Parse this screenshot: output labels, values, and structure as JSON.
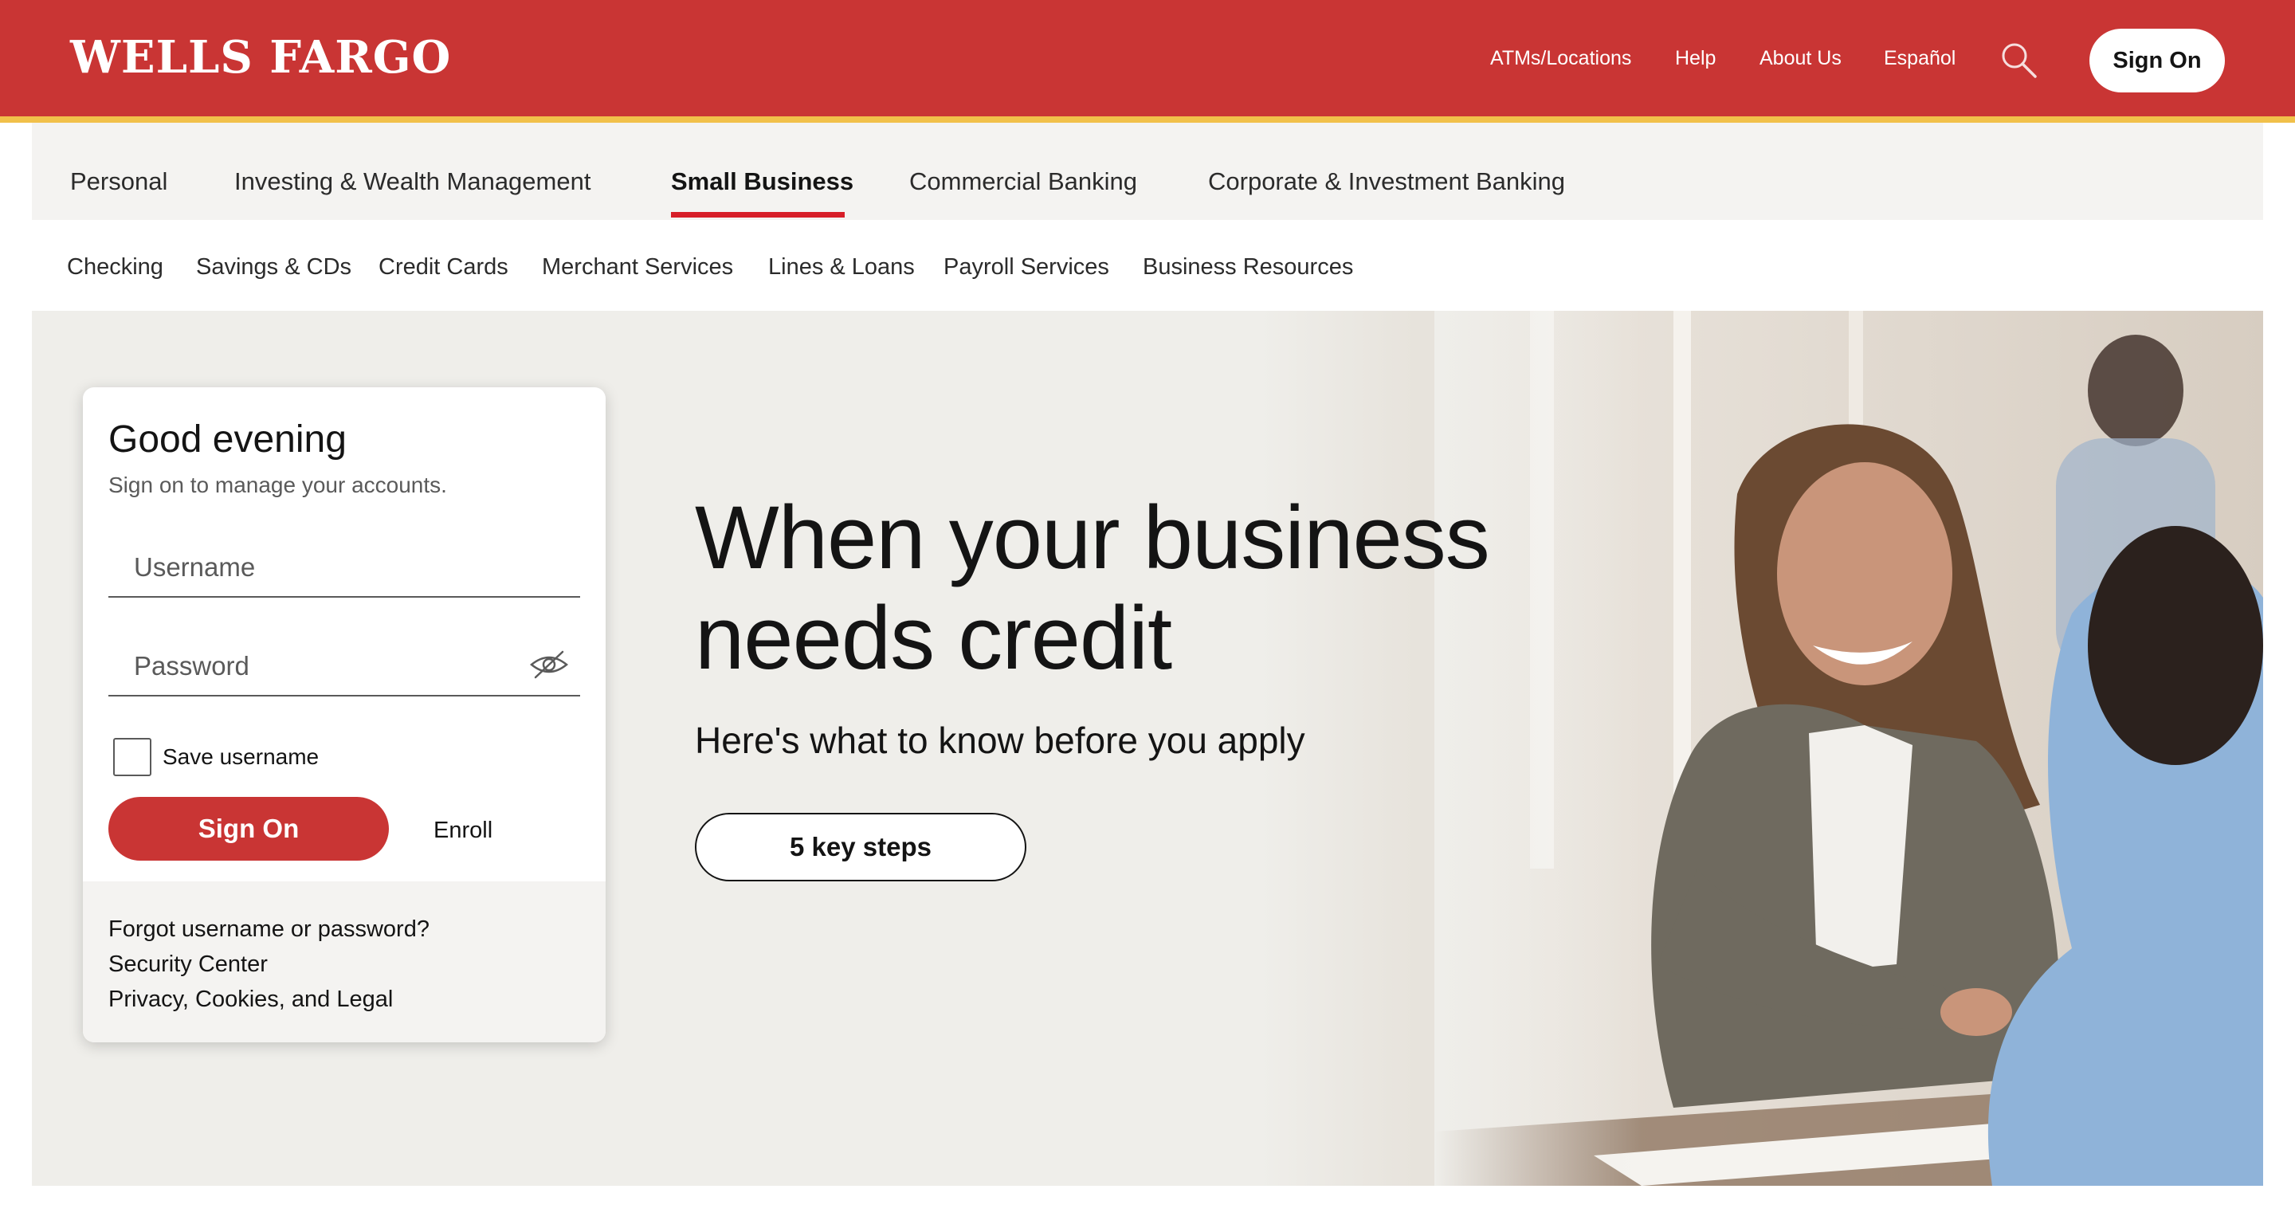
{
  "brand": {
    "logo_text": "WELLS FARGO",
    "primary_color": "#c93534",
    "accent_stripe": "#f1c04a",
    "active_underline": "#d71e28"
  },
  "utility_nav": {
    "items": [
      "ATMs/Locations",
      "Help",
      "About Us",
      "Español"
    ],
    "search_icon": "search-icon",
    "sign_on": "Sign On"
  },
  "primary_nav": {
    "items": [
      "Personal",
      "Investing & Wealth Management",
      "Small Business",
      "Commercial Banking",
      "Corporate & Investment Banking"
    ],
    "active": "Small Business"
  },
  "secondary_nav": {
    "items": [
      "Checking",
      "Savings & CDs",
      "Credit Cards",
      "Merchant Services",
      "Lines & Loans",
      "Payroll Services",
      "Business Resources"
    ]
  },
  "signon_card": {
    "greeting": "Good evening",
    "intro": "Sign on to manage your accounts.",
    "username_placeholder": "Username",
    "password_placeholder": "Password",
    "password_toggle_icon": "eye-slash-icon",
    "save_username_label": "Save username",
    "save_username_checked": false,
    "sign_on_button": "Sign On",
    "enroll_link": "Enroll",
    "footer_links": [
      "Forgot username or password?",
      "Security Center",
      "Privacy, Cookies, and Legal"
    ]
  },
  "hero": {
    "title_line1": "When your business",
    "title_line2": "needs credit",
    "subtitle": "Here's what to know before you apply",
    "cta": "5 key steps"
  }
}
